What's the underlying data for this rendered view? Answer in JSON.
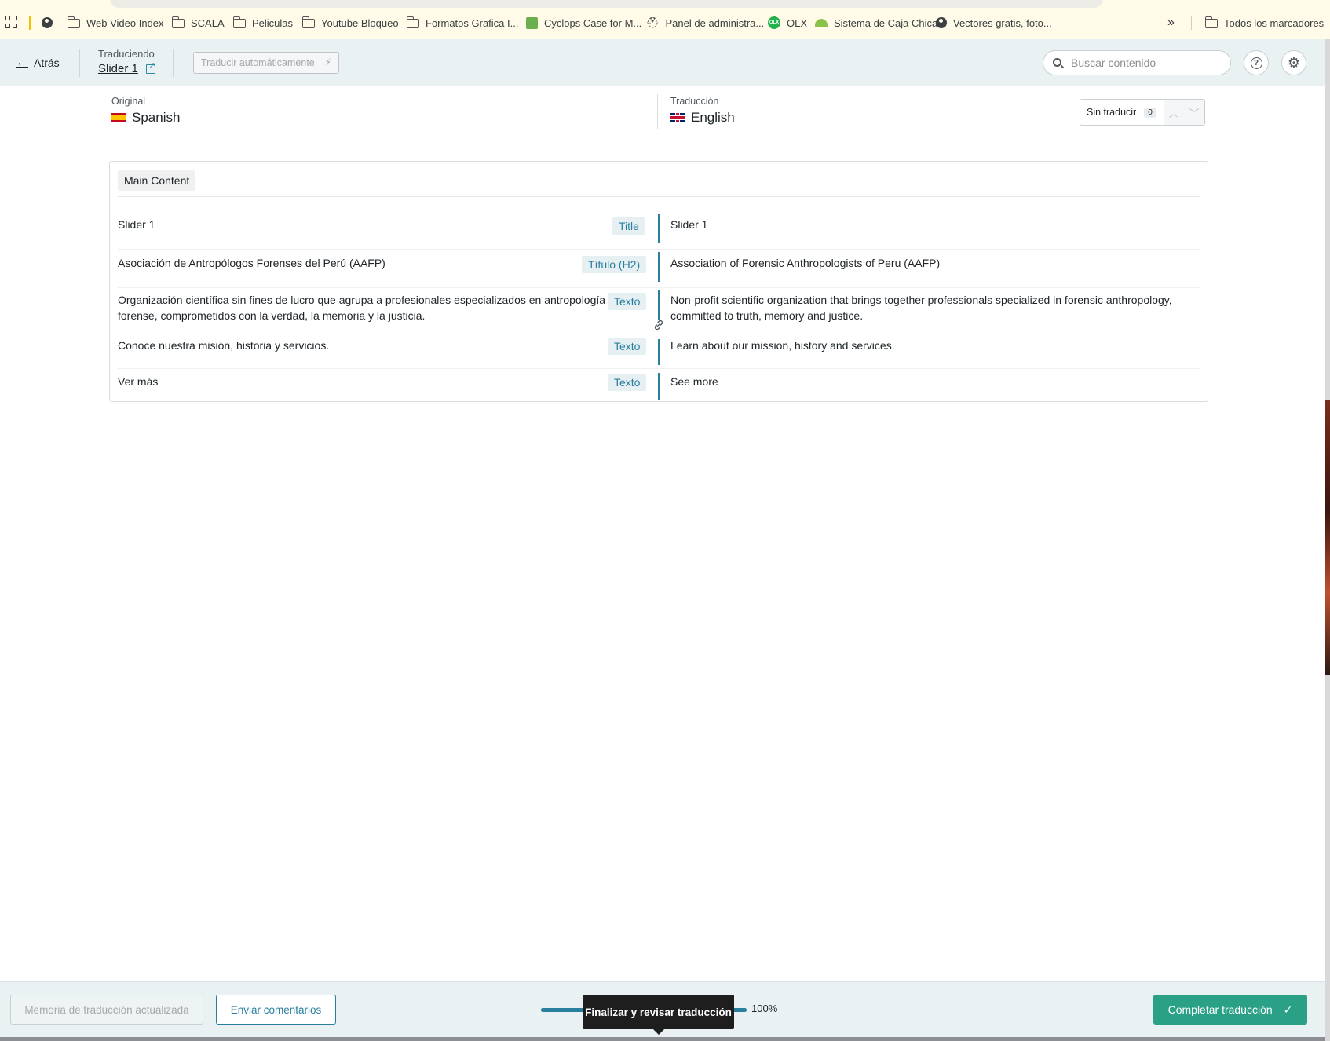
{
  "bookmarks": [
    {
      "label": "Web Video Index",
      "icon": "folder-icon"
    },
    {
      "label": "SCALA",
      "icon": "folder-icon"
    },
    {
      "label": "Peliculas",
      "icon": "folder-icon"
    },
    {
      "label": "Youtube Bloqueo",
      "icon": "folder-icon"
    },
    {
      "label": "Formatos Grafica I...",
      "icon": "folder-icon"
    },
    {
      "label": "Cyclops Case for M...",
      "icon": "green-square-icon"
    },
    {
      "label": "Panel de administra...",
      "icon": "bot-icon"
    },
    {
      "label": "OLX",
      "icon": "olx-icon"
    },
    {
      "label": "Sistema de Caja Chica",
      "icon": "leaf-icon"
    },
    {
      "label": "Vectores gratis, foto...",
      "icon": "globe-icon"
    }
  ],
  "bookmarks_overflow": "»",
  "all_bookmarks": "Todos los marcadores",
  "olx_icon_text": "OLX",
  "header": {
    "back_label": "Atrás",
    "translating_label": "Traduciendo",
    "translating_title": "Slider 1",
    "auto_translate_label": "Traducir automáticamente",
    "search_placeholder": "Buscar contenido"
  },
  "languages": {
    "original_label": "Original",
    "original_language": "Spanish",
    "translation_label": "Traducción",
    "translation_language": "English",
    "untranslated_label": "Sin traducir",
    "untranslated_count": "0"
  },
  "section": {
    "title": "Main Content",
    "rows": [
      {
        "source": "Slider 1",
        "type": "Title",
        "target": "Slider 1"
      },
      {
        "source": "Asociación de Antropólogos Forenses del Perú (AAFP)",
        "type": "Título (H2)",
        "target": "Association of Forensic Anthropologists of Peru (AAFP)"
      },
      {
        "source": "Organización científica sin fines de lucro que agrupa a profesionales especializados en antropología forense, comprometidos con la verdad, la memoria y la justicia.",
        "type": "Texto",
        "target": "Non-profit scientific organization that brings together professionals specialized in forensic anthropology, committed to truth, memory and justice."
      },
      {
        "source": "Conoce nuestra misión, historia y servicios.",
        "type": "Texto",
        "target": "Learn about our mission, history and services."
      },
      {
        "source": "Ver más",
        "type": "Texto",
        "target": "See more"
      }
    ]
  },
  "footer": {
    "tm_label": "Memoria de traducción actualizada",
    "feedback_label": "Enviar comentarios",
    "progress_percent": 100,
    "progress_text": "100%",
    "tooltip": "Finalizar y revisar traducción",
    "complete_label": "Completar traducción"
  },
  "colors": {
    "accent": "#2a7f9e",
    "complete": "#2aa187",
    "header_bg": "#e9f1f3"
  }
}
